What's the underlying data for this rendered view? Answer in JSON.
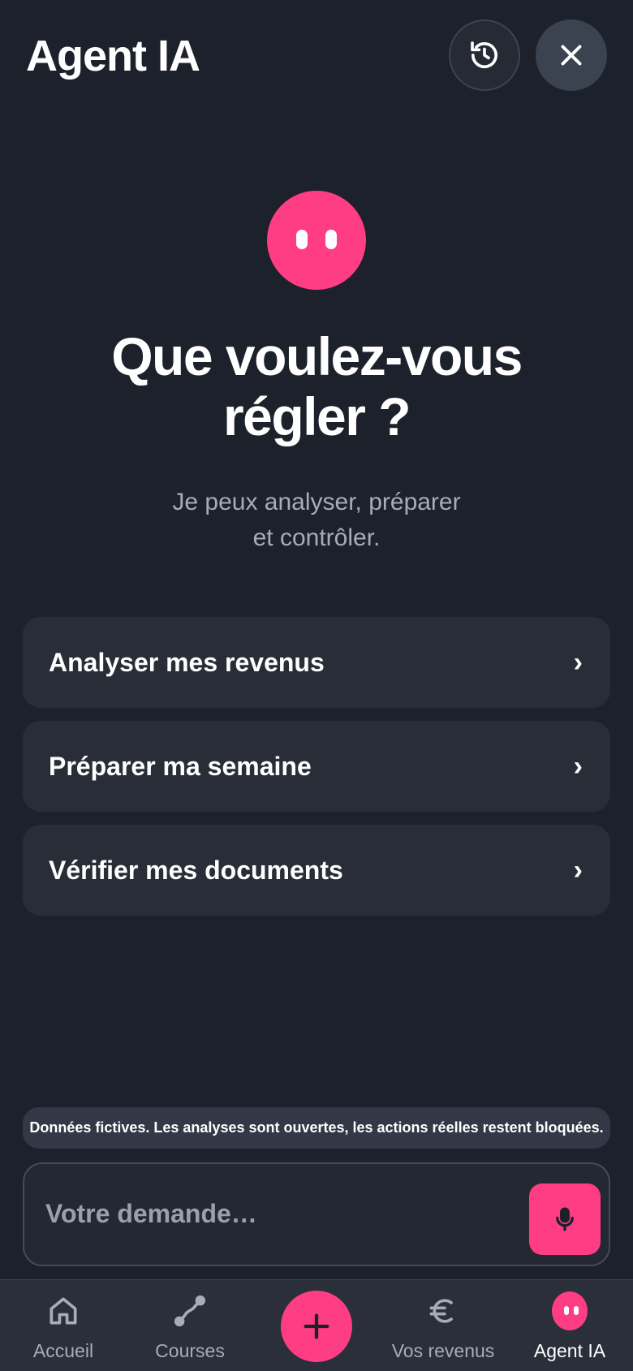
{
  "header": {
    "title": "Agent IA",
    "history_icon": "history-icon",
    "close_icon": "close-icon"
  },
  "hero": {
    "title_line1": "Que voulez-vous",
    "title_line2": "régler ?",
    "subtitle_line1": "Je peux analyser, préparer",
    "subtitle_line2": "et contrôler."
  },
  "actions": [
    {
      "label": "Analyser mes revenus",
      "chevron": "›"
    },
    {
      "label": "Préparer ma semaine",
      "chevron": "›"
    },
    {
      "label": "Vérifier mes documents",
      "chevron": "›"
    }
  ],
  "notice": "Données fictives. Les analyses sont ouvertes, les actions réelles restent bloquées.",
  "composer": {
    "placeholder": "Votre demande…",
    "mic_icon": "microphone-icon"
  },
  "nav": {
    "items": [
      {
        "label": "Accueil",
        "icon": "home-icon"
      },
      {
        "label": "Courses",
        "icon": "route-icon"
      },
      {
        "label": "Vos revenus",
        "icon": "euro-icon"
      },
      {
        "label": "Agent IA",
        "icon": "agent-icon",
        "active": true
      }
    ],
    "fab_icon": "plus-icon"
  },
  "colors": {
    "background": "#1d212b",
    "accent": "#ff3d85",
    "card": "#282d38"
  }
}
